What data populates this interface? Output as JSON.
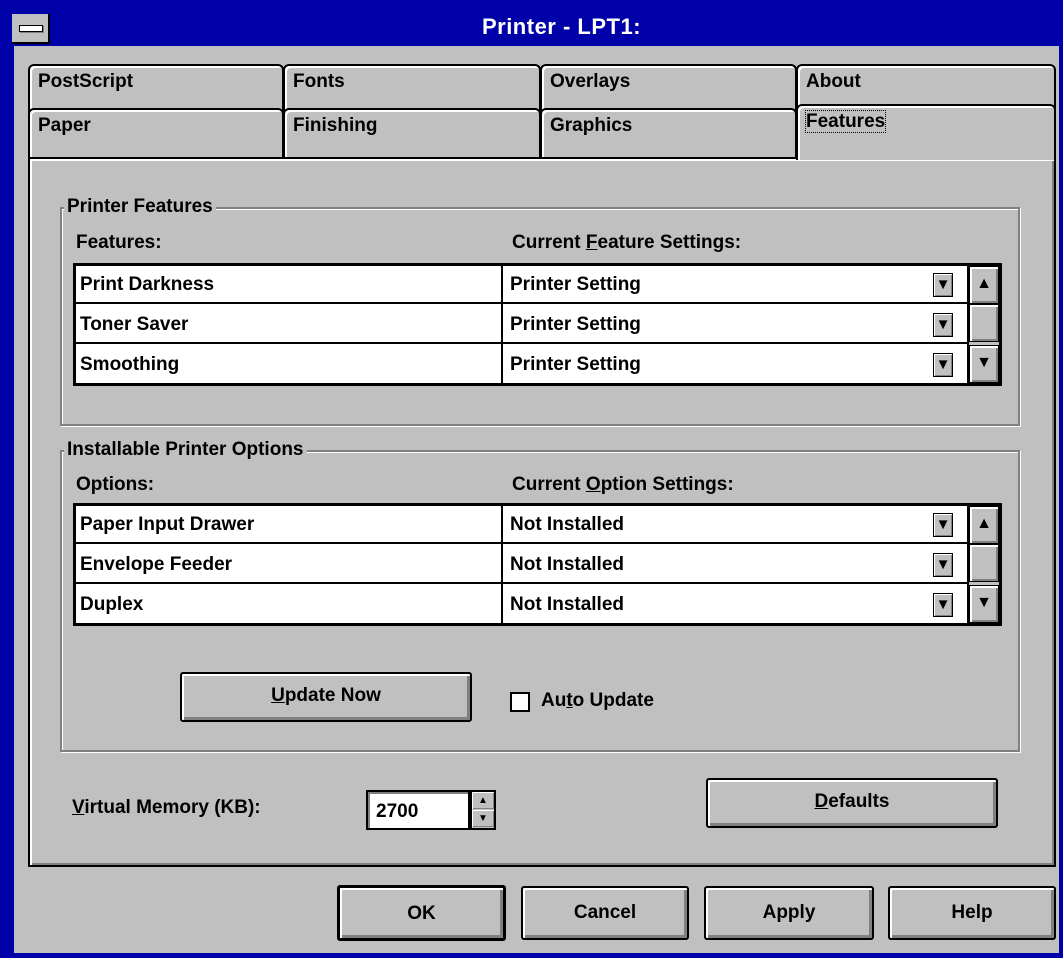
{
  "window": {
    "title": "Printer - LPT1:"
  },
  "tabs": {
    "back_row": [
      "PostScript",
      "Fonts",
      "Overlays",
      "About"
    ],
    "front_row": [
      "Paper",
      "Finishing",
      "Graphics",
      "Features"
    ],
    "active": "Features"
  },
  "printer_features": {
    "group_label": "Printer Features",
    "col1_header": "Features:",
    "col2_header_pre": "Current ",
    "col2_header_accel": "F",
    "col2_header_post": "eature Settings:",
    "rows": [
      {
        "name": "Print Darkness",
        "value": "Printer Setting"
      },
      {
        "name": "Toner Saver",
        "value": "Printer Setting"
      },
      {
        "name": "Smoothing",
        "value": "Printer Setting"
      }
    ]
  },
  "installable_options": {
    "group_label": "Installable Printer Options",
    "col1_header": "Options:",
    "col2_header_pre": "Current ",
    "col2_header_accel": "O",
    "col2_header_post": "ption Settings:",
    "rows": [
      {
        "name": "Paper Input Drawer",
        "value": "Not Installed"
      },
      {
        "name": "Envelope Feeder",
        "value": "Not Installed"
      },
      {
        "name": "Duplex",
        "value": "Not Installed"
      }
    ],
    "update_now": {
      "accel": "U",
      "rest": "pdate Now"
    },
    "auto_update": {
      "pre": "Au",
      "accel": "t",
      "post": "o Update",
      "checked": false
    }
  },
  "virtual_memory": {
    "accel": "V",
    "rest": "irtual Memory (KB):",
    "value": "2700"
  },
  "defaults_button": {
    "accel": "D",
    "rest": "efaults"
  },
  "buttons": {
    "ok": "OK",
    "cancel": "Cancel",
    "apply": "Apply",
    "help": "Help"
  },
  "icons": {
    "dropdown": "down-arrow-icon",
    "scroll_up": "up-arrow-icon",
    "scroll_down": "down-arrow-icon"
  },
  "colors": {
    "titlebar": "#0000a8",
    "face": "#c0c0c0"
  }
}
